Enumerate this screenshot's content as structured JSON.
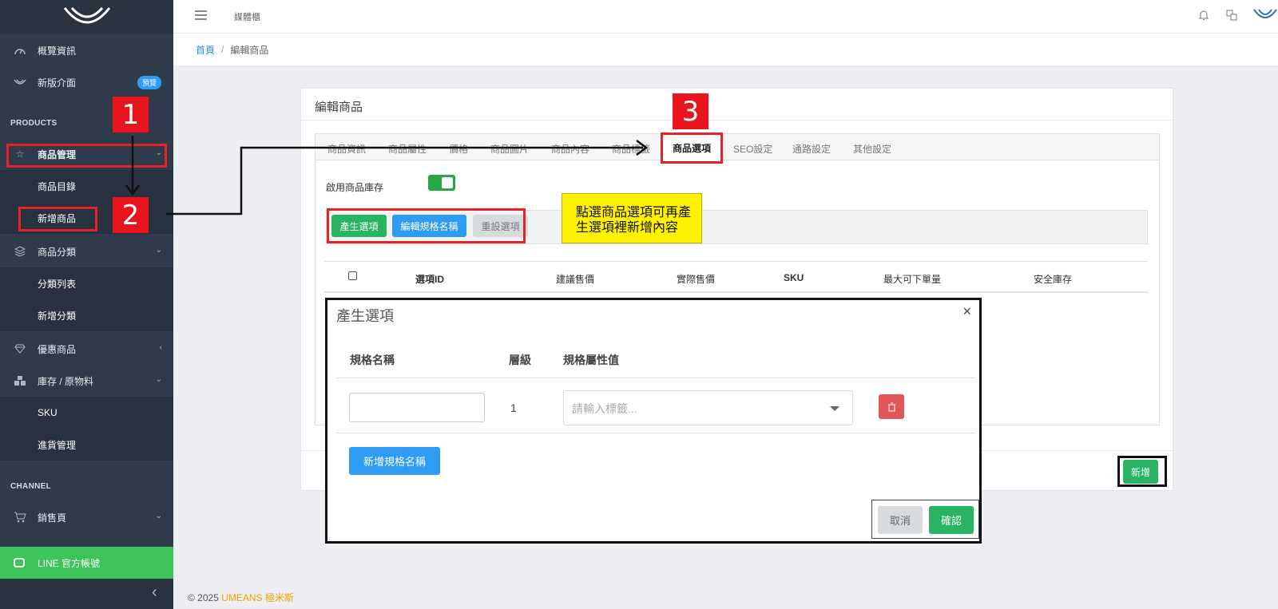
{
  "sidebar": {
    "overview": "概覽資訊",
    "new_ui": "新版介面",
    "new_ui_badge": "預覽",
    "section_products": "PRODUCTS",
    "product_mgmt": "商品管理",
    "product_list": "商品目錄",
    "add_product": "新增商品",
    "product_category": "商品分類",
    "category_list": "分類列表",
    "add_category": "新增分類",
    "discount": "優惠商品",
    "inventory": "庫存 / 原物料",
    "sku": "SKU",
    "purchasing": "進貨管理",
    "section_channel": "CHANNEL",
    "sales_page": "銷售頁",
    "line_account": "LINE 官方帳號"
  },
  "topbar": {
    "title": "媒體櫃"
  },
  "breadcrumb": {
    "home": "首頁",
    "sep": "/",
    "current": "編輯商品"
  },
  "card": {
    "title": "編輯商品",
    "tabs": [
      "商品資訊",
      "商品屬性",
      "價格",
      "商品圖片",
      "商品內容",
      "商品標籤",
      "商品選項",
      "SEO設定",
      "通路設定",
      "其他設定"
    ],
    "inventory_label": "啟用商品庫存",
    "btn_generate": "產生選項",
    "btn_edit_spec": "編輯規格名稱",
    "btn_reset": "重設選項",
    "columns": [
      "選項ID",
      "建議售價",
      "實際售價",
      "SKU",
      "最大可下單量",
      "安全庫存"
    ],
    "btn_add": "新增"
  },
  "modal": {
    "title": "產生選項",
    "close": "×",
    "col_spec_name": "規格名稱",
    "col_level": "層級",
    "col_attr_value": "規格屬性值",
    "row_level": "1",
    "select_placeholder": "請輸入標籤...",
    "btn_add_spec": "新增規格名稱",
    "btn_cancel": "取消",
    "btn_confirm": "確認"
  },
  "annotations": {
    "num1": "1",
    "num2": "2",
    "num3": "3",
    "note_line1": "點選商品選項可再產",
    "note_line2": "生選項裡新增內容"
  },
  "footer": {
    "copyright": "© 2025",
    "brand": "UMEANS 極米斯"
  },
  "colors": {
    "sidebar_bg": "#2f3a4a",
    "accent_green": "#28b463",
    "accent_blue": "#2f9cf3",
    "annotation_red": "#e8202a",
    "note_yellow": "#fff200"
  }
}
